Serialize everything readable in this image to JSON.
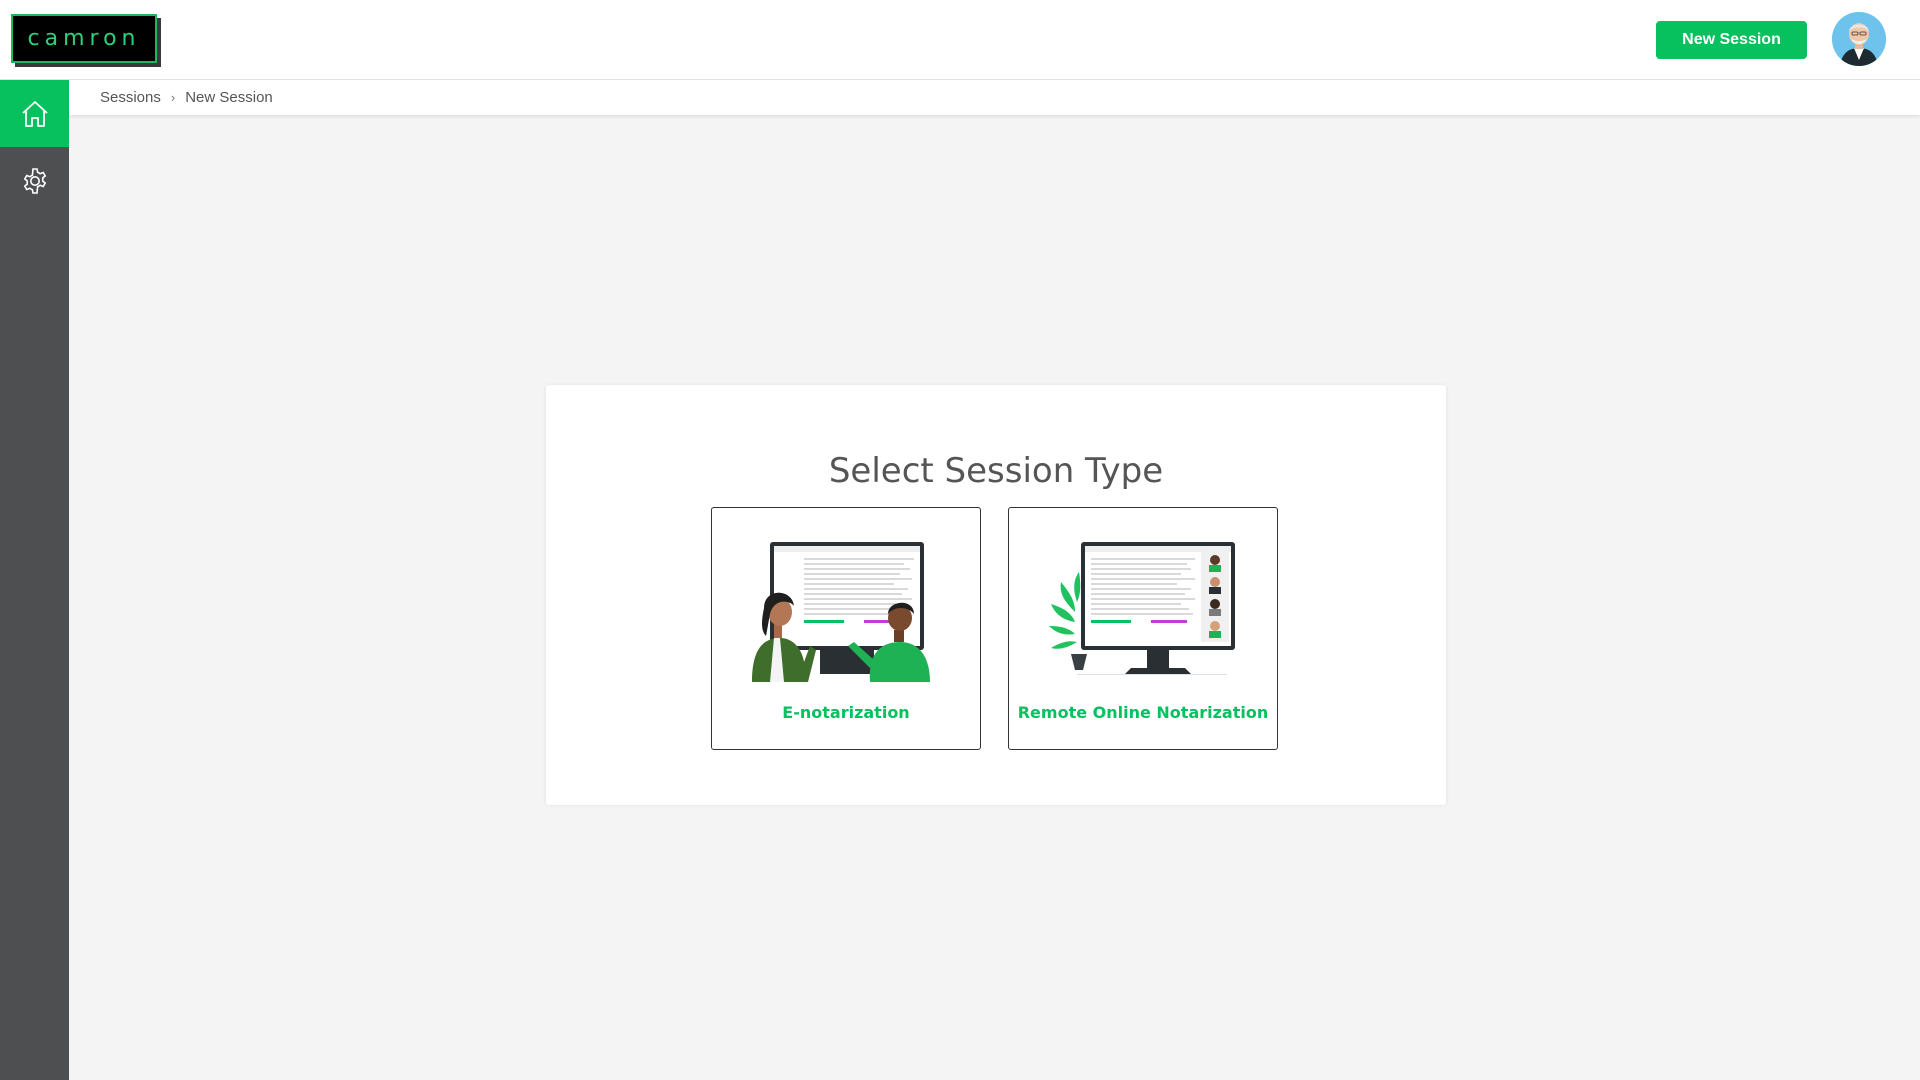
{
  "header": {
    "logo_text": "camron",
    "new_session_label": "New Session"
  },
  "sidebar": {
    "items": [
      {
        "icon": "home-icon",
        "active": true
      },
      {
        "icon": "gear-icon",
        "active": false
      }
    ]
  },
  "breadcrumb": {
    "items": [
      "Sessions",
      "New Session"
    ]
  },
  "main": {
    "title": "Select Session Type",
    "options": [
      {
        "label": "E-notarization",
        "icon": "e-notarization-illustration"
      },
      {
        "label": "Remote Online Notarization",
        "icon": "remote-online-notarization-illustration"
      }
    ]
  },
  "colors": {
    "accent": "#07c15f",
    "sidebar": "#4d4f51",
    "background": "#f4f4f4"
  }
}
